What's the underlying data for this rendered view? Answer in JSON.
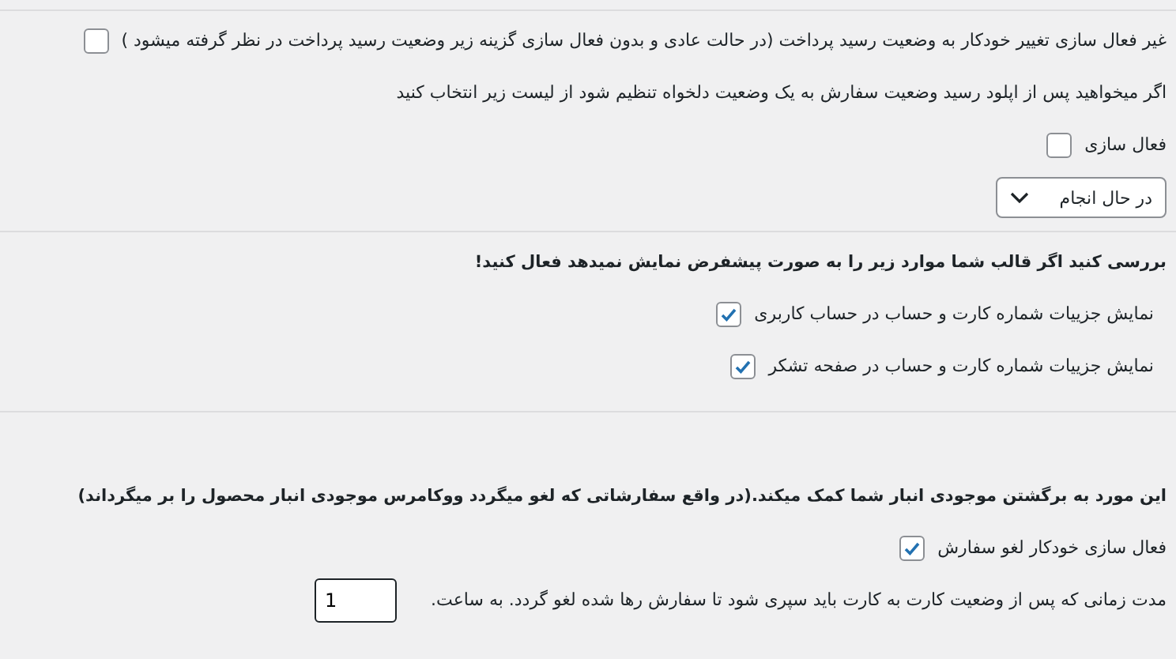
{
  "sections": [
    {
      "items": [
        {
          "kind": "checkbox",
          "label": "غیر فعال سازی تغییر خودکار به وضعیت رسید پرداخت (در حالت عادی و بدون فعال سازی گزینه زیر وضعیت رسید پرداخت در نظر گرفته میشود )",
          "checked": false
        },
        {
          "kind": "text",
          "text": "اگر میخواهید پس از اپلود رسید وضعیت سفارش به یک وضعیت دلخواه تنظیم شود از لیست زیر انتخاب کنید"
        },
        {
          "kind": "checkbox",
          "label": "فعال سازی",
          "checked": false
        },
        {
          "kind": "select",
          "value": "در حال انجام"
        }
      ]
    },
    {
      "items": [
        {
          "kind": "heading",
          "text": "بررسی کنید اگر قالب شما موارد زیر را به صورت پیشفرض نمایش نمیدهد فعال کنید!"
        },
        {
          "kind": "checkbox",
          "label": "نمایش جزییات شماره کارت و حساب در حساب کاربری",
          "checked": true
        },
        {
          "kind": "checkbox",
          "label": "نمایش جزییات شماره کارت و حساب در صفحه تشکر",
          "checked": true
        }
      ]
    },
    {
      "items": [
        {
          "kind": "heading",
          "text": "این مورد به برگشتن موجودی انبار شما کمک میکند.(در واقع سفارشاتی که لغو میگردد ووکامرس موجودی انبار محصول را بر میگرداند)"
        },
        {
          "kind": "checkbox",
          "label": "فعال سازی خودکار لغو سفارش",
          "checked": true
        },
        {
          "kind": "number",
          "label": "مدت زمانی که پس از وضعیت کارت به کارت باید سپری شود تا سفارش رها شده لغو گردد. به ساعت.",
          "value": "1"
        }
      ]
    }
  ]
}
